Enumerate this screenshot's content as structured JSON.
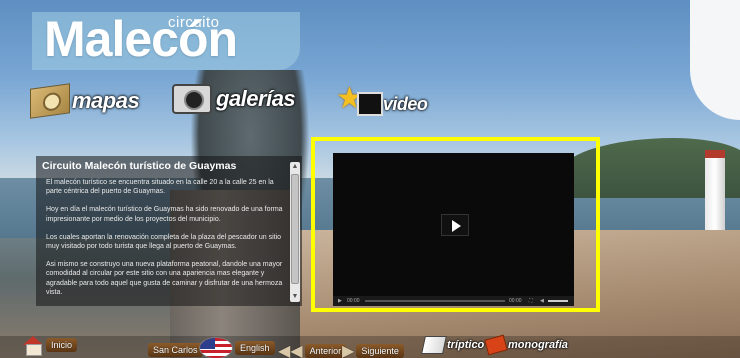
{
  "header": {
    "logo_small": "circuito",
    "logo_big": "Malecón"
  },
  "nav": {
    "mapas": "mapas",
    "galerias": "galerías",
    "video": "video"
  },
  "info": {
    "title": "Circuito Malecón turístico  de Guaymas",
    "paragraphs": [
      "El malecón turístico se encuentra situado en la calle 20 a la calle 25 en la parte céntrica del puerto de Guaymas.",
      "Hoy en día el malecón turístico de Guaymas  ha sido renovado de una forma impresionante por medio de los proyectos del municipio.",
      "Los cuales aportan  la renovación completa de la plaza del pescador un sitio muy visitado por todo turista que llega al puerto de Guaymas.",
      "Asi mismo se  construyo una nueva plataforma peatonal, dandole una mayor comodidad al circular por este sitio con una apariencia mas elegante y agradable para todo aquel  que  gusta de caminar y disfrutar de una hermoza vista."
    ]
  },
  "player": {
    "time_current": "00:00",
    "time_total": "00:00"
  },
  "footer": {
    "inicio": "Inicio",
    "san_carlos": "San Carlos",
    "english": "English",
    "anterior": "Anterior",
    "siguiente": "Siguiente",
    "triptico": "tríptico",
    "monografia": "monografía"
  },
  "colors": {
    "highlight_frame": "#ffff00"
  }
}
